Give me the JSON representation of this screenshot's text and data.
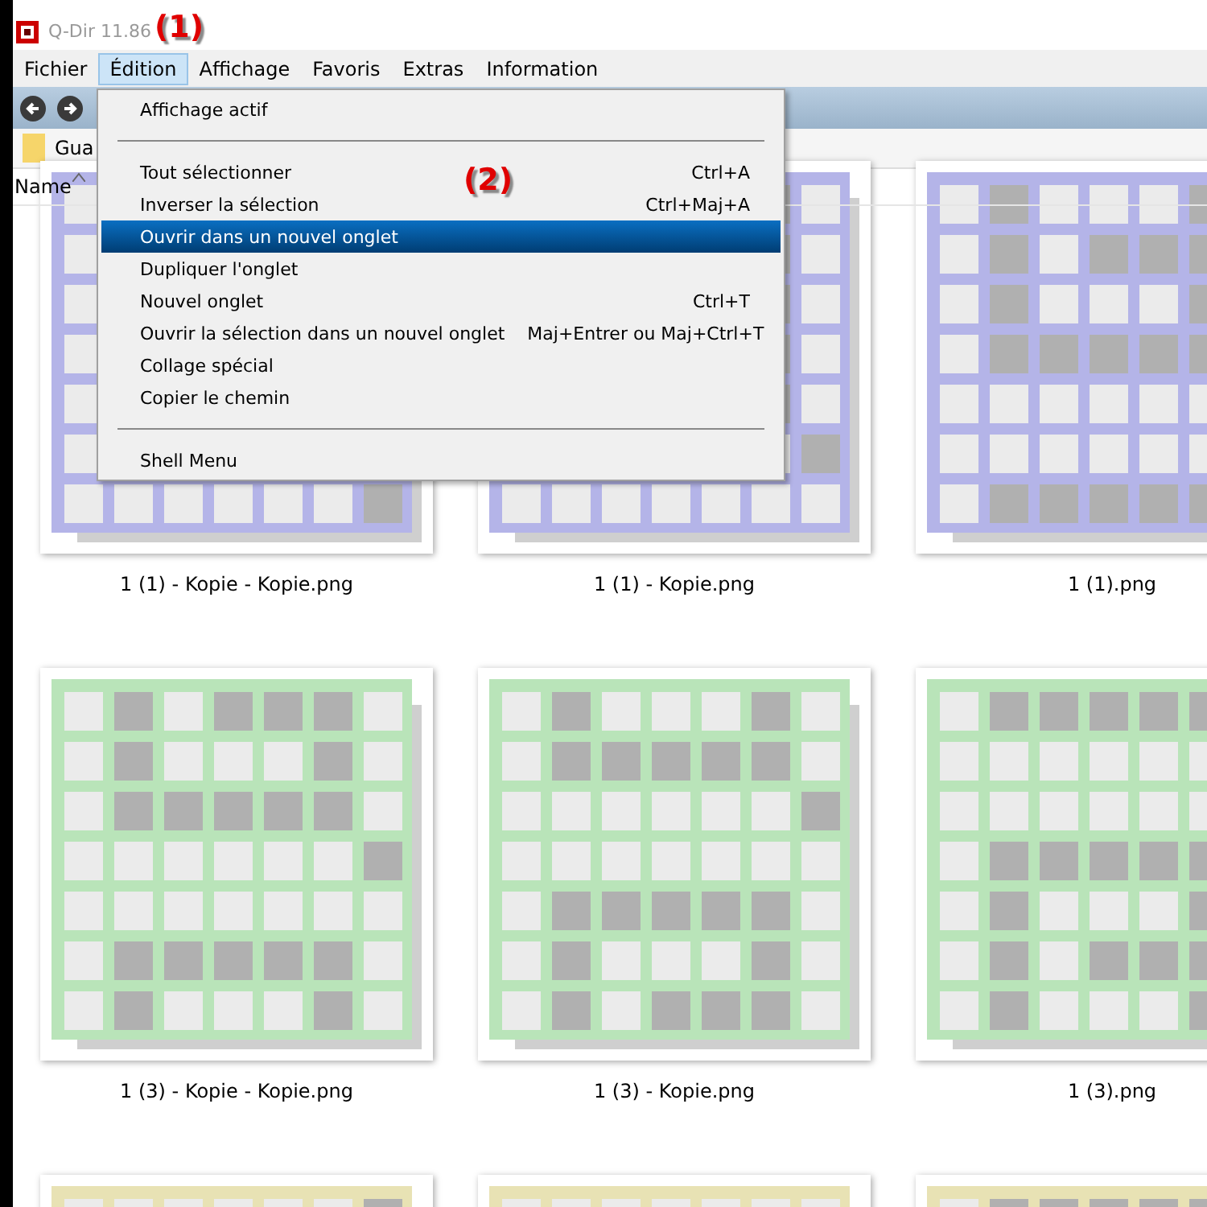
{
  "window": {
    "title": "Q-Dir 11.86"
  },
  "annotations": [
    {
      "text": "(1)"
    },
    {
      "text": "(2)"
    }
  ],
  "menu_bar": [
    {
      "label": "Fichier",
      "selected": false
    },
    {
      "label": "Édition",
      "selected": true
    },
    {
      "label": "Affichage",
      "selected": false
    },
    {
      "label": "Favoris",
      "selected": false
    },
    {
      "label": "Extras",
      "selected": false
    },
    {
      "label": "Information",
      "selected": false
    }
  ],
  "path": {
    "value": "Gua"
  },
  "column_header": {
    "label": "Name",
    "sorted": true
  },
  "menu": [
    {
      "kind": "item",
      "label": "Affichage actif",
      "selected": false
    },
    {
      "kind": "separator"
    },
    {
      "kind": "item",
      "label": "Tout sélectionner",
      "shortcut": "Ctrl+A",
      "selected": false
    },
    {
      "kind": "item",
      "label": "Inverser la sélection",
      "shortcut": "Ctrl+Maj+A",
      "selected": false
    },
    {
      "kind": "item",
      "label": "Ouvrir dans un nouvel onglet",
      "selected": true
    },
    {
      "kind": "item",
      "label": "Dupliquer l'onglet",
      "selected": false
    },
    {
      "kind": "item",
      "label": "Nouvel onglet",
      "shortcut": "Ctrl+T",
      "selected": false
    },
    {
      "kind": "item",
      "label": "Ouvrir la sélection dans un nouvel onglet",
      "shortcut": "Maj+Entrer ou Maj+Ctrl+T",
      "selected": false
    },
    {
      "kind": "item",
      "label": "Collage spécial",
      "selected": false
    },
    {
      "kind": "item",
      "label": "Copier le chemin",
      "selected": false
    },
    {
      "kind": "separator"
    },
    {
      "kind": "item",
      "label": "Shell Menu",
      "selected": false
    }
  ],
  "files": [
    {
      "name": "1 (1) - Kopie - Kopie.png",
      "color": "#b4b4e8"
    },
    {
      "name": "1 (1) - Kopie.png",
      "color": "#b4b4e8"
    },
    {
      "name": "1 (1).png",
      "color": "#b4b4e8"
    },
    {
      "name": "1 (3) - Kopie - Kopie.png",
      "color": "#b9e4b9"
    },
    {
      "name": "1 (3) - Kopie.png",
      "color": "#b9e4b9"
    },
    {
      "name": "1 (3).png",
      "color": "#b9e4b9"
    },
    {
      "color": "#e8e2b4"
    },
    {
      "color": "#e8e2b4"
    },
    {
      "color": "#e8e2b4"
    }
  ]
}
